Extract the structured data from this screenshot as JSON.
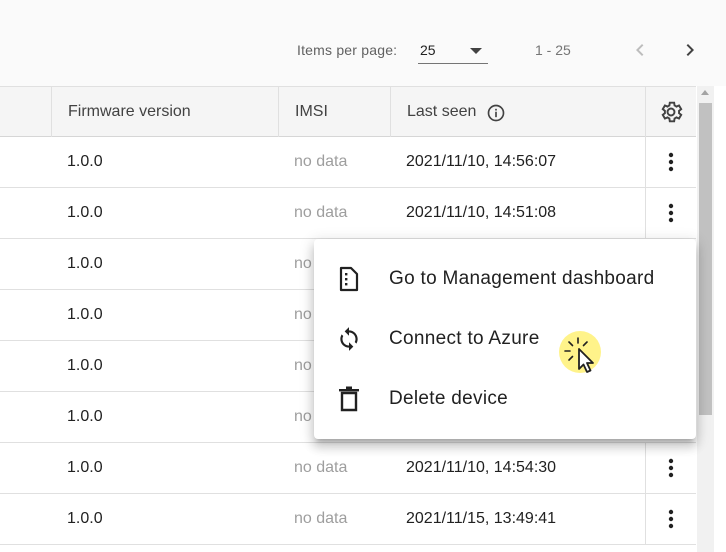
{
  "paginator": {
    "items_per_page_label": "Items per page:",
    "items_per_page_value": "25",
    "range_label": "1 - 25",
    "prev_icon": "chevron-left-icon",
    "next_icon": "chevron-right-icon"
  },
  "table": {
    "headers": {
      "firmware": "Firmware version",
      "imsi": "IMSI",
      "last_seen": "Last seen",
      "info_icon": "info-icon",
      "settings_icon": "gear-icon"
    },
    "rows": [
      {
        "firmware": "1.0.0",
        "imsi": "no data",
        "last_seen": "2021/11/10, 14:56:07"
      },
      {
        "firmware": "1.0.0",
        "imsi": "no data",
        "last_seen": "2021/11/10, 14:51:08"
      },
      {
        "firmware": "1.0.0",
        "imsi": "no",
        "last_seen": ""
      },
      {
        "firmware": "1.0.0",
        "imsi": "no",
        "last_seen": ""
      },
      {
        "firmware": "1.0.0",
        "imsi": "no",
        "last_seen": ""
      },
      {
        "firmware": "1.0.0",
        "imsi": "no",
        "last_seen": ""
      },
      {
        "firmware": "1.0.0",
        "imsi": "no data",
        "last_seen": "2021/11/10, 14:54:30"
      },
      {
        "firmware": "1.0.0",
        "imsi": "no data",
        "last_seen": "2021/11/15, 13:49:41"
      }
    ],
    "row_action_icon": "more-vert-icon"
  },
  "context_menu": {
    "items": [
      {
        "label": "Go to Management dashboard",
        "icon": "dashboard-icon"
      },
      {
        "label": "Connect to Azure",
        "icon": "sync-icon"
      },
      {
        "label": "Delete device",
        "icon": "delete-icon"
      }
    ]
  },
  "colors": {
    "header_bg": "#f5f5f5",
    "muted_text": "#9e9e9e",
    "cursor_highlight": "#fff176"
  }
}
